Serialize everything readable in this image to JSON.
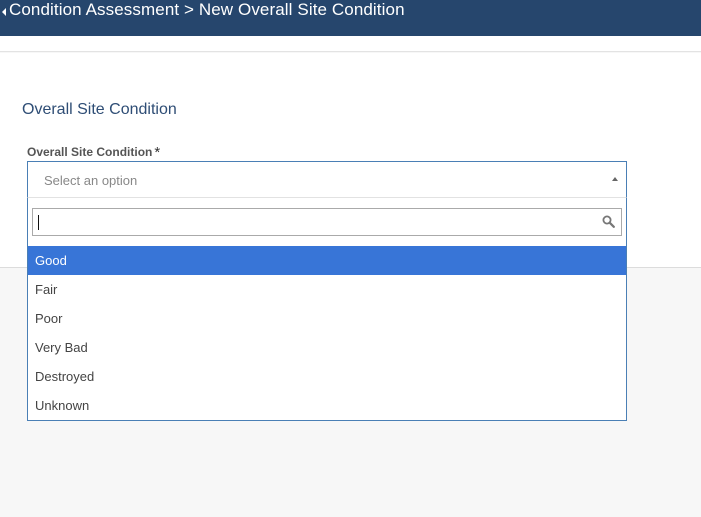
{
  "header": {
    "back_icon": "caret-left-icon",
    "title": "Condition Assessment > New Overall Site Condition"
  },
  "section": {
    "title": "Overall Site Condition"
  },
  "field": {
    "label": "Overall Site Condition",
    "required_marker": "*",
    "placeholder": "Select an option",
    "caret_icon": "caret-up-icon",
    "search_value": "",
    "search_icon": "search-icon"
  },
  "options": [
    {
      "label": "Good",
      "highlighted": true
    },
    {
      "label": "Fair",
      "highlighted": false
    },
    {
      "label": "Poor",
      "highlighted": false
    },
    {
      "label": "Very Bad",
      "highlighted": false
    },
    {
      "label": "Destroyed",
      "highlighted": false
    },
    {
      "label": "Unknown",
      "highlighted": false
    }
  ],
  "colors": {
    "header_bg": "#26466d",
    "highlight_bg": "#3875d7",
    "focus_border": "#4a7fb5"
  }
}
